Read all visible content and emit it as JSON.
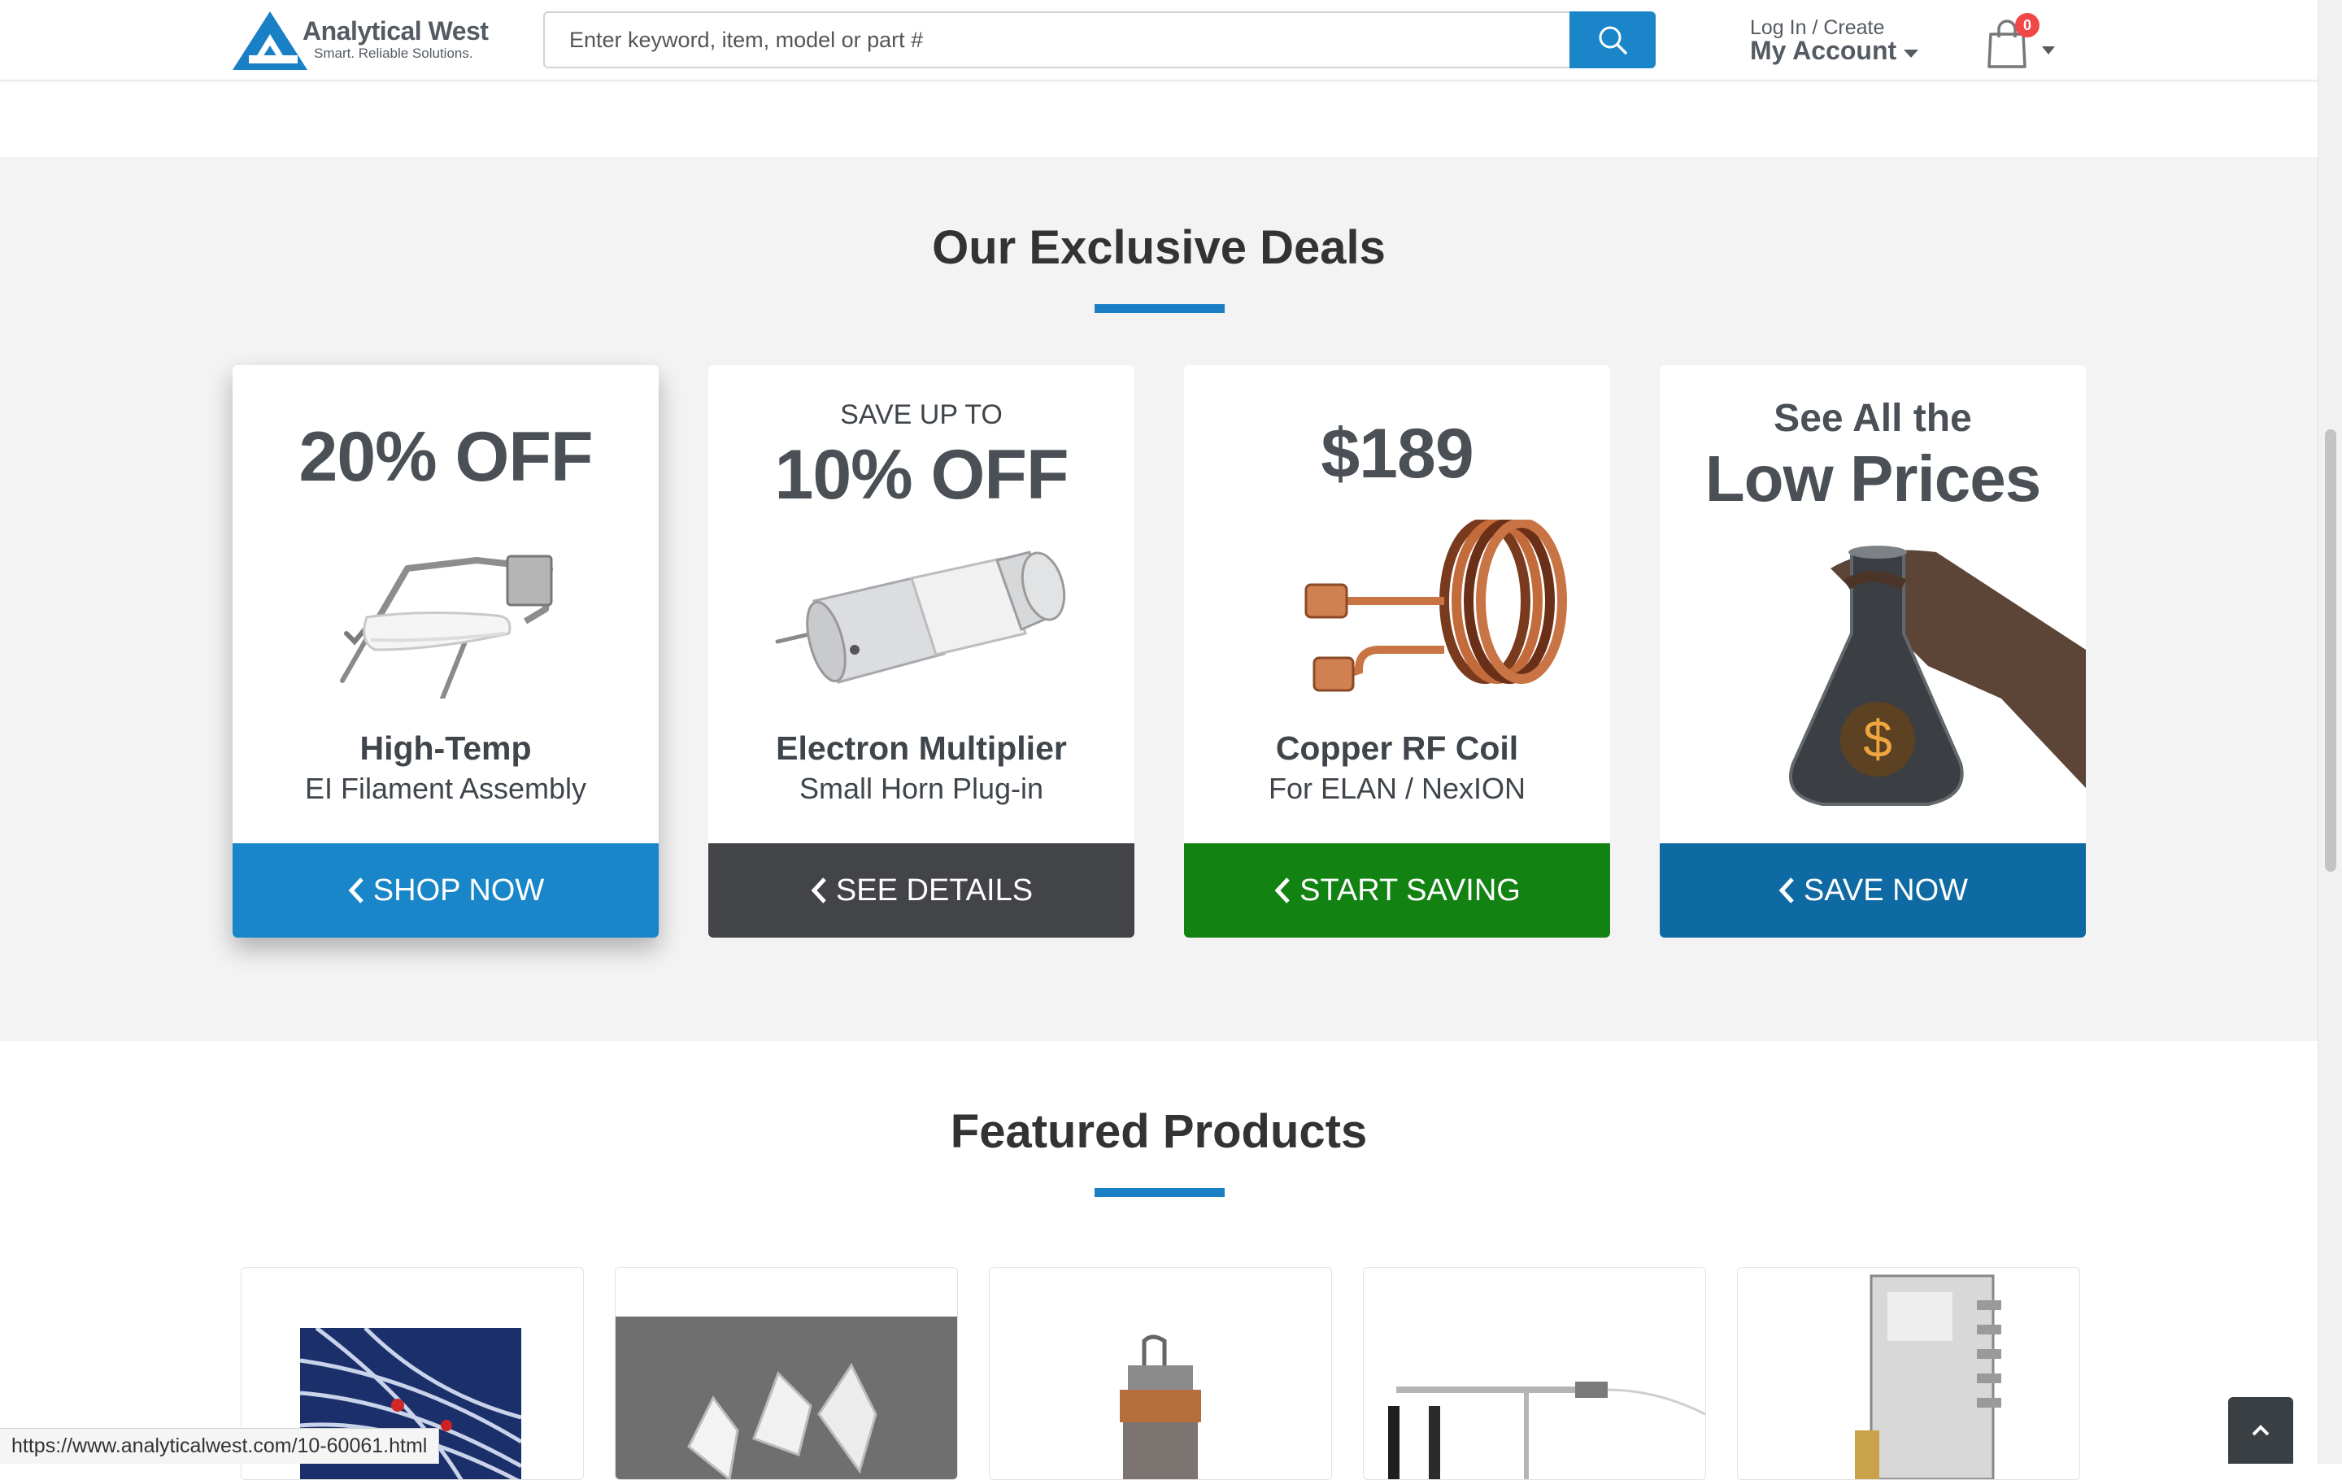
{
  "header": {
    "logo_name": "Analytical West",
    "logo_tagline": "Smart. Reliable Solutions.",
    "search_placeholder": "Enter keyword, item, model or part #",
    "account_small": "Log In / Create",
    "account_big": "My Account",
    "cart_count": "0"
  },
  "deals": {
    "title": "Our Exclusive Deals",
    "cards": [
      {
        "small": "",
        "price": "20% OFF",
        "name": "High-Temp",
        "sub": "EI Filament Assembly",
        "button": "SHOP NOW",
        "color": "#1886c8"
      },
      {
        "small": "SAVE UP TO",
        "price": "10% OFF",
        "name": "Electron Multiplier",
        "sub": "Small Horn Plug-in",
        "button": "SEE DETAILS",
        "color": "#424448"
      },
      {
        "small": "",
        "price": "$189",
        "name": "Copper RF Coil",
        "sub": "For ELAN / NexION",
        "button": "START SAVING",
        "color": "#128212"
      },
      {
        "small": "See All the",
        "price": "Low Prices",
        "name": "",
        "sub": "",
        "button": "SAVE NOW",
        "color": "#0f6aa4"
      }
    ]
  },
  "featured": {
    "title": "Featured Products"
  },
  "status_url": "https://www.analyticalwest.com/10-60061.html",
  "colors": {
    "accent": "#1a86c9",
    "title_bar": "#1a7fc4",
    "section_bg": "#f3f3f3",
    "badge": "#f04747"
  },
  "icons": [
    "logo-triangle-icon",
    "search-icon",
    "caret-down-icon",
    "cart-icon",
    "chevron-left-icon",
    "chevron-up-icon"
  ]
}
